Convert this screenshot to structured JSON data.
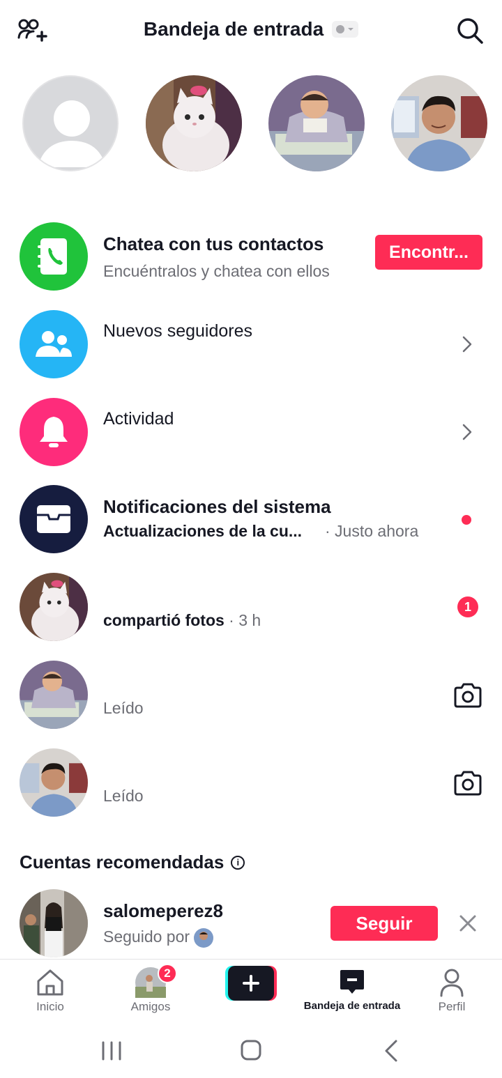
{
  "header": {
    "title": "Bandeja de entrada",
    "add_friends_icon": "add-user-icon",
    "search_icon": "search-icon"
  },
  "stories": [
    "add-story",
    "cat",
    "baby",
    "man"
  ],
  "contacts_row": {
    "title": "Chatea con tus contactos",
    "subtitle": "Encuéntralos y chatea con ellos",
    "button": "Encontr...",
    "icon_color": "#20c33b"
  },
  "followers_row": {
    "title": "Nuevos seguidores",
    "icon_color": "#25b5f5"
  },
  "activity_row": {
    "title": "Actividad",
    "icon_color": "#fe2c7b"
  },
  "system_row": {
    "title": "Notificaciones del sistema",
    "subtitle": "Actualizaciones de la cu...",
    "time": "· Justo ahora",
    "icon_color": "#161d3f"
  },
  "messages": [
    {
      "text": "compartió fotos",
      "time": "· 3 h",
      "badge": "1"
    },
    {
      "text": "Leído"
    },
    {
      "text": "Leído"
    }
  ],
  "recommended": {
    "section_title": "Cuentas recomendadas",
    "username": "salomeperez8",
    "followed_by": "Seguido por",
    "follow_button": "Seguir"
  },
  "nav": {
    "home": "Inicio",
    "friends": "Amigos",
    "friends_badge": "2",
    "inbox": "Bandeja de entrada",
    "profile": "Perfil"
  },
  "colors": {
    "accent": "#fe2c55",
    "text": "#161823",
    "muted": "#6c6d74"
  }
}
